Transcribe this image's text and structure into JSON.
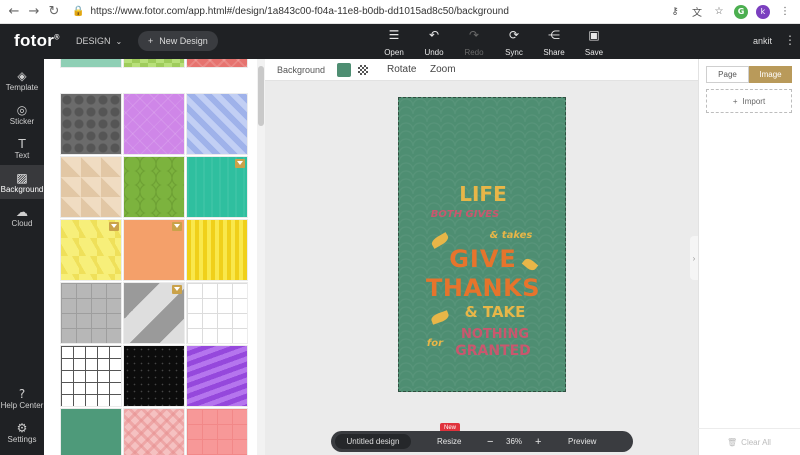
{
  "browser": {
    "url": "https://www.fotor.com/app.html#/design/1a843c00-f04a-11e8-b0db-dd1015ad8c50/background",
    "profile_initial": "k"
  },
  "header": {
    "logo": "fotor",
    "logo_mark": "®",
    "design_menu": "DESIGN",
    "new_design": "New Design",
    "tools": [
      {
        "label": "Open",
        "icon": "open-icon"
      },
      {
        "label": "Undo",
        "icon": "undo-icon"
      },
      {
        "label": "Redo",
        "icon": "redo-icon"
      },
      {
        "label": "Sync",
        "icon": "sync-icon"
      },
      {
        "label": "Share",
        "icon": "share-icon"
      },
      {
        "label": "Save",
        "icon": "save-icon"
      }
    ],
    "username": "ankit"
  },
  "sidebar": {
    "items": [
      {
        "label": "Template",
        "icon": "layers-icon"
      },
      {
        "label": "Sticker",
        "icon": "sticker-icon"
      },
      {
        "label": "Text",
        "icon": "text-icon"
      },
      {
        "label": "Background",
        "icon": "background-icon"
      },
      {
        "label": "Cloud",
        "icon": "cloud-icon"
      }
    ],
    "bottom_items": [
      {
        "label": "Help Center",
        "icon": "help-icon"
      },
      {
        "label": "Settings",
        "icon": "settings-icon"
      }
    ]
  },
  "canvas_toolbar": {
    "background_label": "Background",
    "color": "#4e8e72",
    "rotate": "Rotate",
    "zoom": "Zoom"
  },
  "poster": {
    "line1": "LIFE",
    "line2": "BOTH GIVES",
    "line2b": "& takes",
    "line3": "GIVE",
    "line4": "THANKS",
    "line5": "& TAKE",
    "line6": "NOTHING",
    "line6b": "for",
    "line7": "GRANTED"
  },
  "right_panel": {
    "tab_page": "Page",
    "tab_image": "Image",
    "import": "Import",
    "clear_all": "Clear All"
  },
  "bottom_bar": {
    "design_name": "Untitled design",
    "new_badge": "New",
    "resize": "Resize",
    "zoom_minus": "−",
    "zoom_value": "36%",
    "zoom_plus": "+",
    "preview": "Preview"
  },
  "colors": {
    "accent": "#b99a5a",
    "dark": "#1f2124",
    "canvas_green": "#4e8e72",
    "poster_yellow": "#e8b648",
    "poster_orange": "#e6742c",
    "poster_pink": "#c9576e"
  }
}
